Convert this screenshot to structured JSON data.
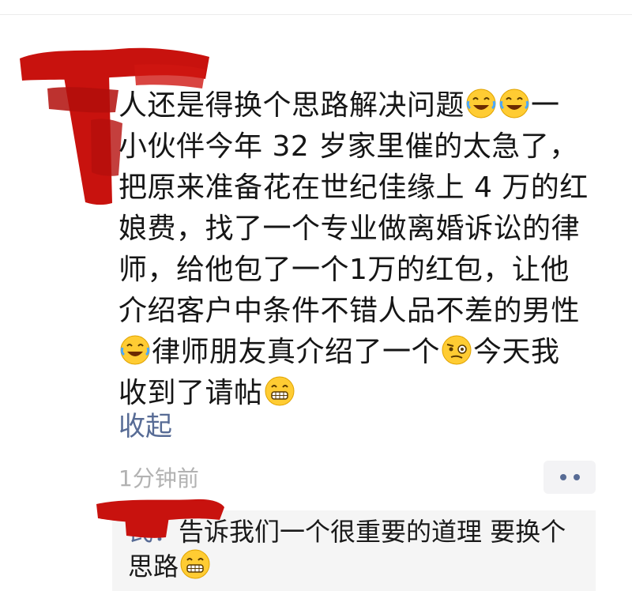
{
  "post": {
    "text_lines": [
      "人还是得换个思路解决问题",
      "小伙伴今年 32 岁家里催的太急了，",
      "把原来准备花在世纪佳缘上 4 万的红",
      "娘费，找了一个专业做离婚诉讼的律",
      "师，给他包了一个1万的红包，让他",
      "介绍客户中条件不错人品不差的男性",
      "律师朋友真介绍了一个",
      "今天我",
      "收到了请帖"
    ],
    "line1_tail": "一",
    "collapse_label": "收起",
    "time_ago": "1分钟前"
  },
  "comment": {
    "name_fragment": "：",
    "name_fragment_tail": "氏",
    "text_line1": "告诉我们一个很重要的道理 要换个",
    "text_line2": "思路"
  },
  "colors": {
    "link": "#576b95",
    "text": "#161616",
    "meta": "#b2b2b2",
    "comment_bg": "#f5f5f5",
    "redaction": "#c8120e"
  },
  "icons": [
    "laughing-tears-emoji",
    "skeptical-monocle-emoji",
    "grinning-emoji",
    "more-dots-icon"
  ]
}
